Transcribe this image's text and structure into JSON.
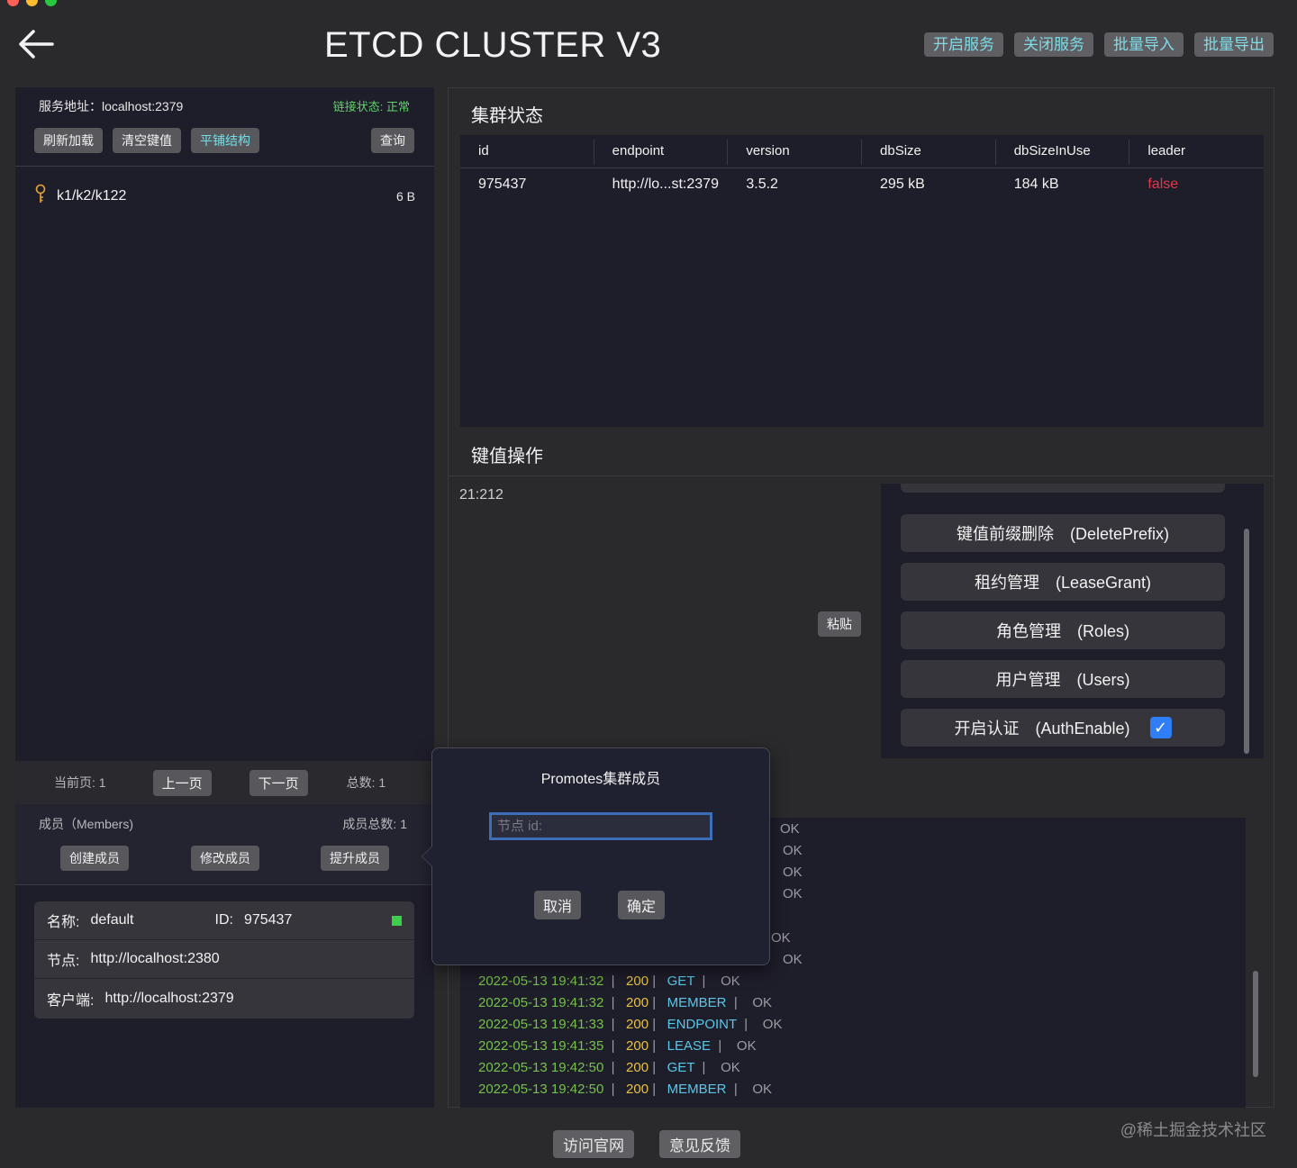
{
  "app": {
    "title": "ETCD CLUSTER V3"
  },
  "top_buttons": [
    "开启服务",
    "关闭服务",
    "批量导入",
    "批量导出"
  ],
  "left": {
    "service_address": "服务地址：localhost:2379",
    "link_status": "链接状态: 正常",
    "buttons": {
      "reload": "刷新加载",
      "clear": "清空键值",
      "flat": "平铺结构",
      "query": "查询"
    },
    "tree": [
      {
        "key": "k1/k2/k122",
        "size": "6 B"
      }
    ],
    "pager": {
      "current": "当前页: 1",
      "prev": "上一页",
      "next": "下一页",
      "total": "总数: 1"
    },
    "members": {
      "title": "成员（Members)",
      "count": "成员总数: 1",
      "buttons": {
        "create": "创建成员",
        "modify": "修改成员",
        "promote": "提升成员"
      },
      "card": {
        "name_label": "名称:",
        "name_value": "default",
        "id_label": "ID:",
        "id_value": "975437",
        "node_label": "节点:",
        "node_value": "http://localhost:2380",
        "client_label": "客户端:",
        "client_value": "http://localhost:2379",
        "status_color": "#3ecf4a"
      }
    }
  },
  "cluster": {
    "title": "集群状态",
    "columns": [
      "id",
      "endpoint",
      "version",
      "dbSize",
      "dbSizeInUse",
      "leader"
    ],
    "row": [
      "975437",
      "http://lo...st:2379",
      "3.5.2",
      "295 kB",
      "184 kB",
      "false"
    ]
  },
  "kv": {
    "title": "键值操作",
    "cursor": "21:212",
    "paste": "粘贴",
    "ops": [
      "键值前缀删除　(DeletePrefix)",
      "租约管理　(LeaseGrant)",
      "角色管理　(Roles)",
      "用户管理　(Users)",
      "开启认证　(AuthEnable)"
    ],
    "auth_checked": true
  },
  "logs": {
    "partial_ok": [
      "OK",
      "OK",
      "OK",
      "OK",
      "OK",
      "OK"
    ],
    "lines": [
      {
        "ts": "2022-05-13 19:41:32",
        "code": "200",
        "verb": "GET",
        "msg": "OK"
      },
      {
        "ts": "2022-05-13 19:41:32",
        "code": "200",
        "verb": "MEMBER",
        "msg": "OK"
      },
      {
        "ts": "2022-05-13 19:41:33",
        "code": "200",
        "verb": "ENDPOINT",
        "msg": "OK"
      },
      {
        "ts": "2022-05-13 19:41:35",
        "code": "200",
        "verb": "LEASE",
        "msg": "OK"
      },
      {
        "ts": "2022-05-13 19:42:50",
        "code": "200",
        "verb": "GET",
        "msg": "OK"
      },
      {
        "ts": "2022-05-13 19:42:50",
        "code": "200",
        "verb": "MEMBER",
        "msg": "OK"
      }
    ]
  },
  "popover": {
    "title": "Promotes集群成员",
    "placeholder": "节点 id:",
    "cancel": "取消",
    "confirm": "确定"
  },
  "footer": {
    "website": "访问官网",
    "feedback": "意见反馈"
  },
  "watermark": "@稀土掘金技术社区"
}
